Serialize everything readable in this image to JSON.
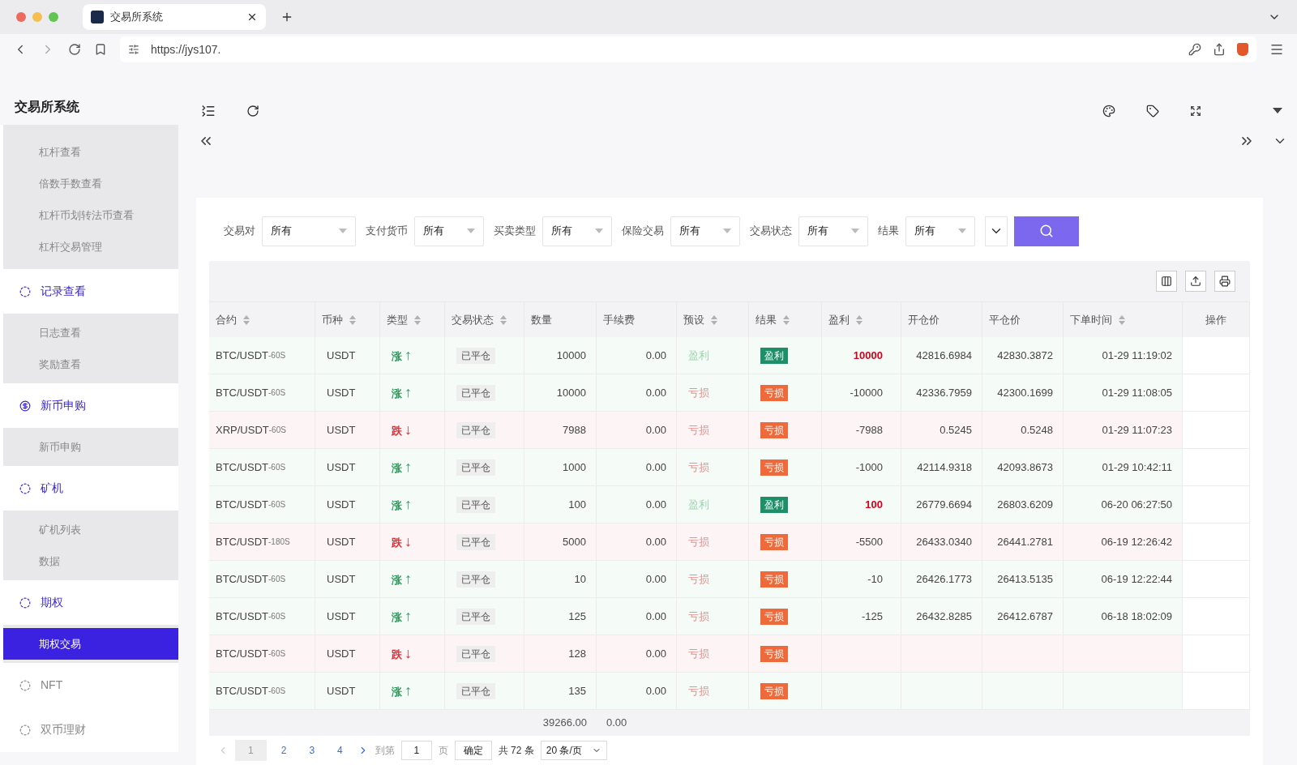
{
  "browser": {
    "tab_title": "交易所系统",
    "url": "https://jys107."
  },
  "sidebar": {
    "title": "交易所系统",
    "top_items": [
      {
        "label": "杠杆查看",
        "selected": false
      },
      {
        "label": "倍数手数查看",
        "selected": false
      },
      {
        "label": "杠杆币划转法币查看",
        "selected": false
      },
      {
        "label": "杠杆交易管理",
        "selected": false
      }
    ],
    "groups": [
      {
        "label": "记录查看",
        "kind": "circle",
        "expanded": true,
        "children": [
          {
            "label": "日志查看",
            "selected": false
          },
          {
            "label": "奖励查看",
            "selected": false
          }
        ]
      },
      {
        "label": "新币申购",
        "kind": "dollar",
        "expanded": true,
        "children": [
          {
            "label": "新币申购",
            "selected": false
          }
        ]
      },
      {
        "label": "矿机",
        "kind": "circle",
        "expanded": true,
        "children": [
          {
            "label": "矿机列表",
            "selected": false
          },
          {
            "label": "数据",
            "selected": false
          }
        ]
      },
      {
        "label": "期权",
        "kind": "circle",
        "expanded": true,
        "children": [
          {
            "label": "期权交易",
            "selected": true
          }
        ]
      },
      {
        "label": "NFT",
        "kind": "circle",
        "expanded": false
      },
      {
        "label": "双币理财",
        "kind": "circle",
        "expanded": false
      }
    ]
  },
  "filters": [
    {
      "label": "交易对",
      "value": "所有"
    },
    {
      "label": "支付货币",
      "value": "所有"
    },
    {
      "label": "买卖类型",
      "value": "所有"
    },
    {
      "label": "保险交易",
      "value": "所有"
    },
    {
      "label": "交易状态",
      "value": "所有"
    },
    {
      "label": "结果",
      "value": "所有"
    }
  ],
  "table": {
    "columns": [
      {
        "label": "合约",
        "sortable": true
      },
      {
        "label": "币种",
        "sortable": true
      },
      {
        "label": "类型",
        "sortable": true
      },
      {
        "label": "交易状态",
        "sortable": true
      },
      {
        "label": "数量",
        "sortable": false
      },
      {
        "label": "手续费",
        "sortable": false
      },
      {
        "label": "预设",
        "sortable": true
      },
      {
        "label": "结果",
        "sortable": true
      },
      {
        "label": "盈利",
        "sortable": true
      },
      {
        "label": "开仓价",
        "sortable": false
      },
      {
        "label": "平仓价",
        "sortable": false
      },
      {
        "label": "下单时间",
        "sortable": true
      },
      {
        "label": "操作",
        "sortable": false
      }
    ],
    "rows": [
      {
        "pair": "BTC/USDT",
        "period": "-60S",
        "currency": "USDT",
        "direction": {
          "kind": "up",
          "label": "涨",
          "arrow": "↑"
        },
        "status": "已平仓",
        "qty": "10000",
        "fee": "0.00",
        "preset": {
          "kind": "profit",
          "label": "盈利"
        },
        "result": {
          "kind": "profit",
          "label": "盈利"
        },
        "pl": "10000",
        "open": "42816.6984",
        "close": "42830.3872",
        "time": "01-29 11:19:02"
      },
      {
        "pair": "BTC/USDT",
        "period": "-60S",
        "currency": "USDT",
        "direction": {
          "kind": "up",
          "label": "涨",
          "arrow": "↑"
        },
        "status": "已平仓",
        "qty": "10000",
        "fee": "0.00",
        "preset": {
          "kind": "loss",
          "label": "亏损"
        },
        "result": {
          "kind": "loss",
          "label": "亏损"
        },
        "pl": "-10000",
        "open": "42336.7959",
        "close": "42300.1699",
        "time": "01-29 11:08:05"
      },
      {
        "pair": "XRP/USDT",
        "period": "-60S",
        "currency": "USDT",
        "direction": {
          "kind": "down",
          "label": "跌",
          "arrow": "↓"
        },
        "status": "已平仓",
        "qty": "7988",
        "fee": "0.00",
        "preset": {
          "kind": "loss",
          "label": "亏损"
        },
        "result": {
          "kind": "loss",
          "label": "亏损"
        },
        "pl": "-7988",
        "open": "0.5245",
        "close": "0.5248",
        "time": "01-29 11:07:23"
      },
      {
        "pair": "BTC/USDT",
        "period": "-60S",
        "currency": "USDT",
        "direction": {
          "kind": "up",
          "label": "涨",
          "arrow": "↑"
        },
        "status": "已平仓",
        "qty": "1000",
        "fee": "0.00",
        "preset": {
          "kind": "loss",
          "label": "亏损"
        },
        "result": {
          "kind": "loss",
          "label": "亏损"
        },
        "pl": "-1000",
        "open": "42114.9318",
        "close": "42093.8673",
        "time": "01-29 10:42:11"
      },
      {
        "pair": "BTC/USDT",
        "period": "-60S",
        "currency": "USDT",
        "direction": {
          "kind": "up",
          "label": "涨",
          "arrow": "↑"
        },
        "status": "已平仓",
        "qty": "100",
        "fee": "0.00",
        "preset": {
          "kind": "profit",
          "label": "盈利"
        },
        "result": {
          "kind": "profit",
          "label": "盈利"
        },
        "pl": "100",
        "open": "26779.6694",
        "close": "26803.6209",
        "time": "06-20 06:27:50"
      },
      {
        "pair": "BTC/USDT",
        "period": "-180S",
        "currency": "USDT",
        "direction": {
          "kind": "down",
          "label": "跌",
          "arrow": "↓"
        },
        "status": "已平仓",
        "qty": "5000",
        "fee": "0.00",
        "preset": {
          "kind": "loss",
          "label": "亏损"
        },
        "result": {
          "kind": "loss",
          "label": "亏损"
        },
        "pl": "-5500",
        "open": "26433.0340",
        "close": "26441.2781",
        "time": "06-19 12:26:42"
      },
      {
        "pair": "BTC/USDT",
        "period": "-60S",
        "currency": "USDT",
        "direction": {
          "kind": "up",
          "label": "涨",
          "arrow": "↑"
        },
        "status": "已平仓",
        "qty": "10",
        "fee": "0.00",
        "preset": {
          "kind": "loss",
          "label": "亏损"
        },
        "result": {
          "kind": "loss",
          "label": "亏损"
        },
        "pl": "-10",
        "open": "26426.1773",
        "close": "26413.5135",
        "time": "06-19 12:22:44"
      },
      {
        "pair": "BTC/USDT",
        "period": "-60S",
        "currency": "USDT",
        "direction": {
          "kind": "up",
          "label": "涨",
          "arrow": "↑"
        },
        "status": "已平仓",
        "qty": "125",
        "fee": "0.00",
        "preset": {
          "kind": "loss",
          "label": "亏损"
        },
        "result": {
          "kind": "loss",
          "label": "亏损"
        },
        "pl": "-125",
        "open": "26432.8285",
        "close": "26412.6787",
        "time": "06-18 18:02:09"
      },
      {
        "pair": "BTC/USDT",
        "period": "-60S",
        "currency": "USDT",
        "direction": {
          "kind": "down",
          "label": "跌",
          "arrow": "↓"
        },
        "status": "已平仓",
        "qty": "128",
        "fee": "0.00",
        "preset": {
          "kind": "loss",
          "label": "亏损"
        },
        "result": {
          "kind": "loss",
          "label": "亏损"
        }
      },
      {
        "pair": "BTC/USDT",
        "period": "-60S",
        "currency": "USDT",
        "direction": {
          "kind": "up",
          "label": "涨",
          "arrow": "↑"
        },
        "status": "已平仓",
        "qty": "135",
        "fee": "0.00",
        "preset": {
          "kind": "loss",
          "label": "亏损"
        },
        "result": {
          "kind": "loss",
          "label": "亏损"
        }
      }
    ],
    "totals": {
      "qty": "39266.00",
      "fee": "0.00"
    }
  },
  "pagination": {
    "pages": [
      {
        "label": "1",
        "selected": true
      },
      {
        "label": "2",
        "selected": false
      },
      {
        "label": "3",
        "selected": false
      },
      {
        "label": "4",
        "selected": false
      }
    ],
    "goto_label": "到第",
    "goto_value": "1",
    "page_suffix": "页",
    "confirm": "确定",
    "total": "共 72 条",
    "page_size": "20 条/页"
  }
}
